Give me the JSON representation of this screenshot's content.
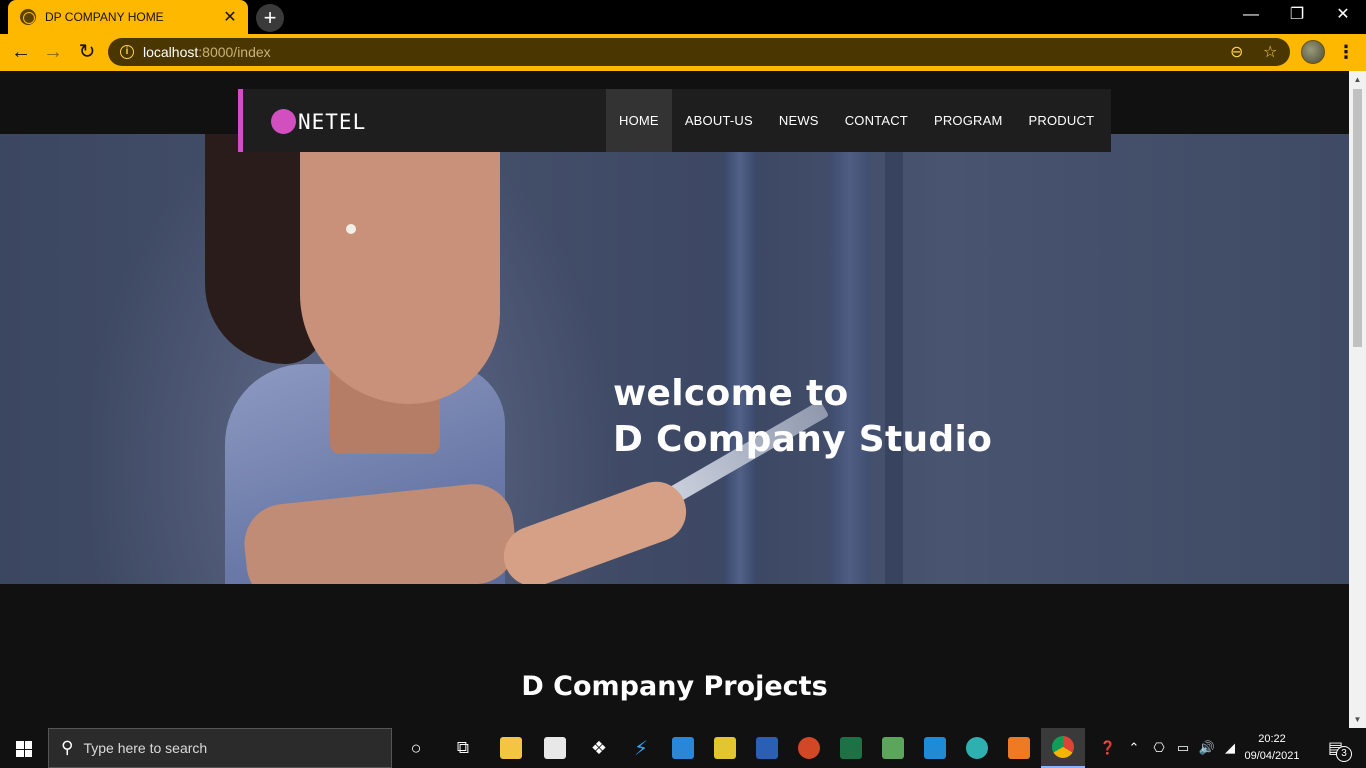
{
  "browser": {
    "tab_title": "DP COMPANY HOME",
    "tab_close": "✕",
    "new_tab": "+",
    "url_host": "localhost",
    "url_path": ":8000/index",
    "window_minimize": "—",
    "window_restore": "❐",
    "window_close": "✕"
  },
  "site": {
    "logo_text": "NETEL",
    "menu": [
      {
        "label": "HOME",
        "active": true
      },
      {
        "label": "ABOUT-US"
      },
      {
        "label": "NEWS"
      },
      {
        "label": "CONTACT"
      },
      {
        "label": "PROGRAM"
      },
      {
        "label": "PRODUCT"
      }
    ],
    "hero_line1": "welcome to",
    "hero_line2": "D Company Studio",
    "projects_title": "D Company Projects"
  },
  "taskbar": {
    "search_placeholder": "Type here to search",
    "clock_time": "20:22",
    "clock_date": "09/04/2021",
    "notification_count": "3"
  },
  "colors": {
    "chrome_accent": "#ffb800",
    "brand_magenta": "#d24fc0",
    "nav_bg": "#1e1e1e"
  }
}
